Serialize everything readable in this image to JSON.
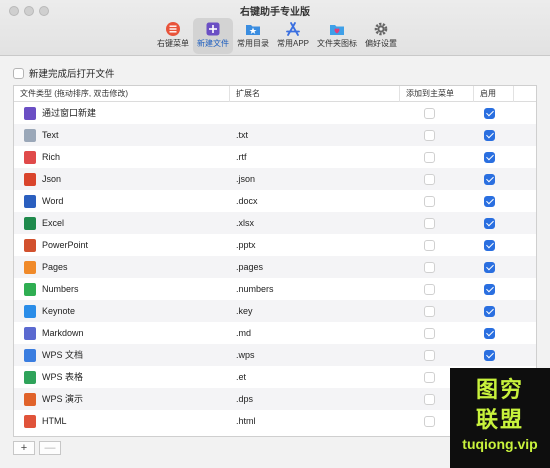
{
  "window": {
    "title": "右键助手专业版"
  },
  "toolbar": {
    "items": [
      {
        "label": "右键菜单",
        "icon": "menu-icon",
        "color": "#e8533a"
      },
      {
        "label": "新建文件",
        "icon": "new-file-icon",
        "color": "#6b4fc4",
        "active": true
      },
      {
        "label": "常用目录",
        "icon": "folder-star-icon",
        "color": "#3a8de0"
      },
      {
        "label": "常用APP",
        "icon": "app-store-icon",
        "color": "#3a6fe0"
      },
      {
        "label": "文件夹图标",
        "icon": "folder-heart-icon",
        "color": "#3fa0e8"
      },
      {
        "label": "偏好设置",
        "icon": "gear-icon",
        "color": "#666666"
      }
    ]
  },
  "option": {
    "label": "新建完成后打开文件",
    "checked": false
  },
  "table": {
    "headers": [
      "文件类型 (拖动排序, 双击修改)",
      "扩展名",
      "添加到主菜单",
      "启用"
    ],
    "rows": [
      {
        "name": "通过窗口新建",
        "ext": "",
        "main": false,
        "enabled": true,
        "icon": "new-window-icon",
        "color": "#6b4fc4"
      },
      {
        "name": "Text",
        "ext": ".txt",
        "main": false,
        "enabled": true,
        "icon": "text-file-icon",
        "color": "#9aa7b8"
      },
      {
        "name": "Rich",
        "ext": ".rtf",
        "main": false,
        "enabled": true,
        "icon": "rtf-file-icon",
        "color": "#e04a4a"
      },
      {
        "name": "Json",
        "ext": ".json",
        "main": false,
        "enabled": true,
        "icon": "json-file-icon",
        "color": "#d9442c"
      },
      {
        "name": "Word",
        "ext": ".docx",
        "main": false,
        "enabled": true,
        "icon": "word-icon",
        "color": "#2b5fbf"
      },
      {
        "name": "Excel",
        "ext": ".xlsx",
        "main": false,
        "enabled": true,
        "icon": "excel-icon",
        "color": "#1f8a4c"
      },
      {
        "name": "PowerPoint",
        "ext": ".pptx",
        "main": false,
        "enabled": true,
        "icon": "powerpoint-icon",
        "color": "#d2512e"
      },
      {
        "name": "Pages",
        "ext": ".pages",
        "main": false,
        "enabled": true,
        "icon": "pages-icon",
        "color": "#f08a2a"
      },
      {
        "name": "Numbers",
        "ext": ".numbers",
        "main": false,
        "enabled": true,
        "icon": "numbers-icon",
        "color": "#2fae52"
      },
      {
        "name": "Keynote",
        "ext": ".key",
        "main": false,
        "enabled": true,
        "icon": "keynote-icon",
        "color": "#2b8de8"
      },
      {
        "name": "Markdown",
        "ext": ".md",
        "main": false,
        "enabled": true,
        "icon": "markdown-icon",
        "color": "#5b6ad0"
      },
      {
        "name": "WPS 文档",
        "ext": ".wps",
        "main": false,
        "enabled": true,
        "icon": "wps-doc-icon",
        "color": "#3a7de0"
      },
      {
        "name": "WPS 表格",
        "ext": ".et",
        "main": false,
        "enabled": false,
        "icon": "wps-sheet-icon",
        "color": "#2fa35a"
      },
      {
        "name": "WPS 演示",
        "ext": ".dps",
        "main": false,
        "enabled": false,
        "icon": "wps-slides-icon",
        "color": "#e0622a"
      },
      {
        "name": "HTML",
        "ext": ".html",
        "main": false,
        "enabled": false,
        "icon": "html-file-icon",
        "color": "#e0533a"
      }
    ]
  },
  "bottom": {
    "add": "+",
    "remove": "—"
  },
  "watermark": {
    "line1": "图穷",
    "line2": "联盟",
    "line3": "tuqiong.vip"
  }
}
